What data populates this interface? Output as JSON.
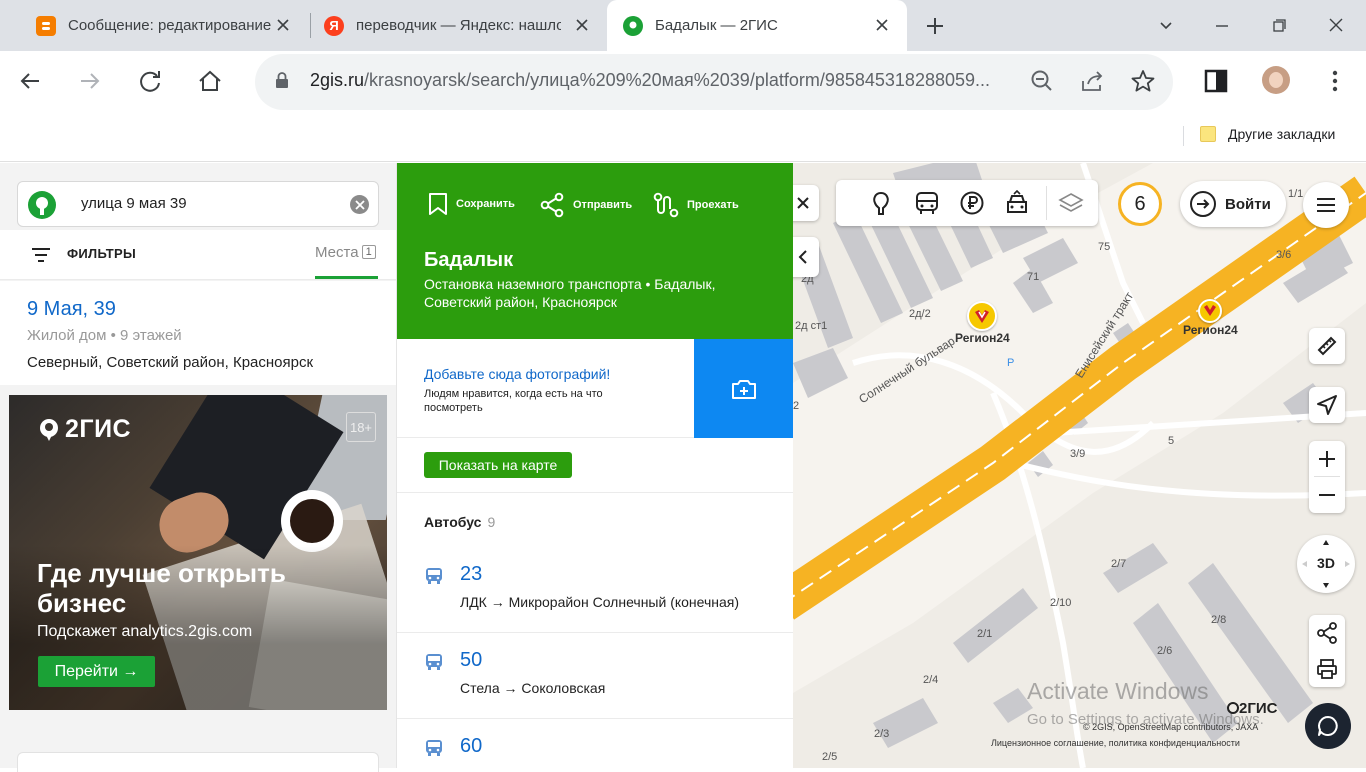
{
  "browser": {
    "tabs": [
      {
        "title": "Сообщение: редактирование",
        "favicon": "blogger-icon",
        "color": "#f57d00"
      },
      {
        "title": "переводчик — Яндекс: нашло",
        "favicon": "yandex-icon",
        "color": "#fc3f1d"
      },
      {
        "title": "Бадалык — 2ГИС",
        "favicon": "2gis-icon",
        "color": "#1ba136"
      }
    ],
    "url_host": "2gis.ru",
    "url_path": "/krasnoyarsk/search/улица%209%20мая%2039/platform/985845318288059...",
    "bookmarks_other": "Другие закладки"
  },
  "search": {
    "query": "улица 9 мая 39",
    "filters_label": "ФИЛЬТРЫ",
    "places_label": "Места",
    "places_count": "1"
  },
  "result": {
    "name": "9 Мая, 39",
    "meta_type": "Жилой дом",
    "meta_floors": "9 этажей",
    "address": "Северный, Советский район, Красноярск"
  },
  "ad": {
    "brand": "2ГИС",
    "age": "18+",
    "headline": "Где лучше открыть бизнес",
    "subline": "Подскажет analytics.2gis.com",
    "cta": "Перейти →"
  },
  "card": {
    "save": "Сохранить",
    "share": "Отправить",
    "route": "Проехать",
    "title": "Бадалык",
    "description": "Остановка наземного транспорта • Бадалык, Советский район, Красноярск",
    "photo_title": "Добавьте сюда фотографий!",
    "photo_sub": "Людям нравится, когда есть на что посмотреть",
    "show_on_map": "Показать на карте",
    "bus_label": "Автобус",
    "bus_count": "9",
    "routes": [
      {
        "number": "23",
        "direction": "ЛДК → Микрорайон Солнечный (конечная)"
      },
      {
        "number": "50",
        "direction": "Стела → Соколовская"
      },
      {
        "number": "60",
        "direction": ""
      }
    ]
  },
  "map": {
    "badge": "6",
    "login": "Войти",
    "btn_3d": "3D",
    "poi": [
      {
        "name": "Регион24"
      },
      {
        "name": "Регион24"
      }
    ],
    "streets": [
      "Солнечный бульвар",
      "Енисейский тракт"
    ],
    "houses": [
      "75",
      "71",
      "3/6",
      "2д ст1",
      "2д/2",
      "2д",
      "3/9",
      "5",
      "2/7",
      "2/10",
      "2/8",
      "2/1",
      "2/6",
      "2/4",
      "2/3",
      "2/5",
      "1/1",
      "2"
    ],
    "parking": "P",
    "copyright": "© 2GIS, OpenStreetMap contributors, JAXA",
    "license": "Лицензионное соглашение, политика конфиденциальности",
    "logo": "2ГИС",
    "watermark1": "Activate Windows",
    "watermark2": "Go to Settings to activate Windows."
  },
  "colors": {
    "brand_green": "#2c9d0d",
    "link_blue": "#1068c9",
    "road_orange": "#f6b323",
    "photo_blue": "#0d88f2"
  }
}
